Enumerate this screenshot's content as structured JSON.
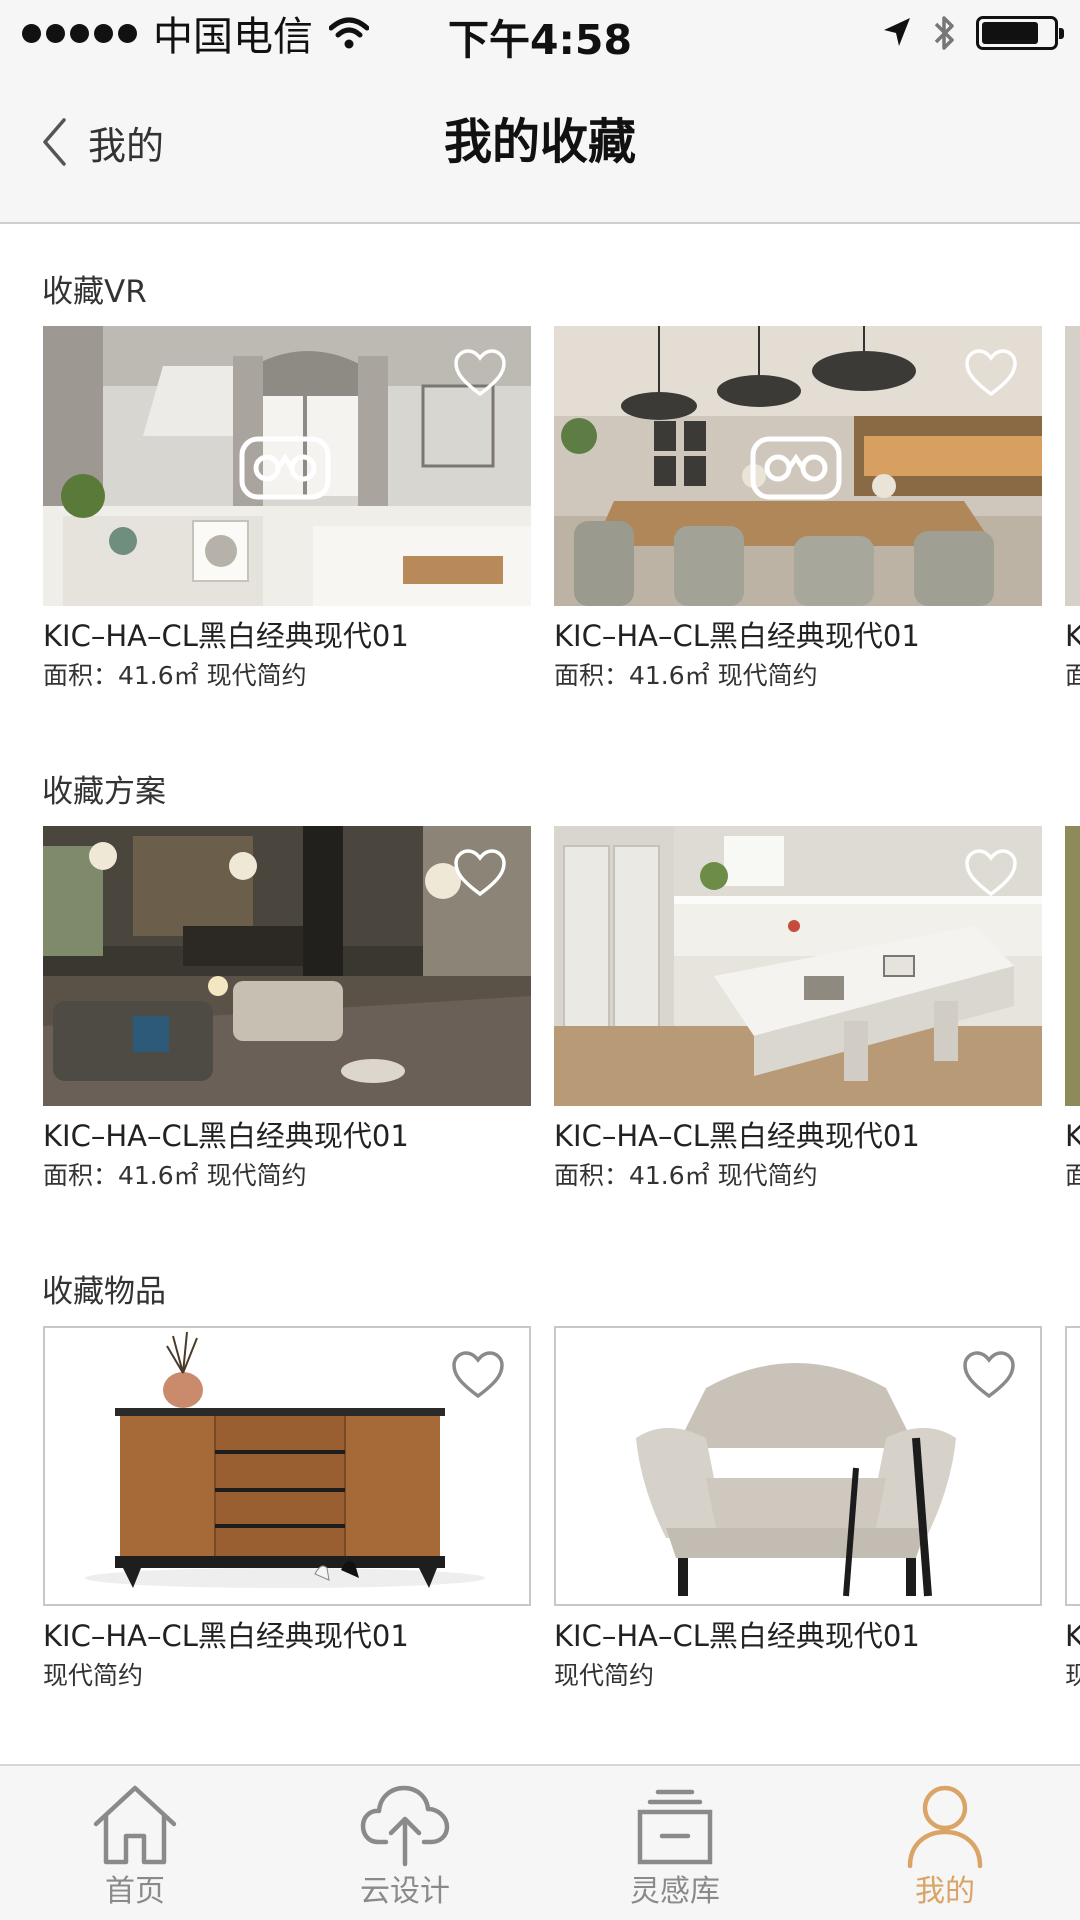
{
  "status_bar": {
    "carrier": "中国电信",
    "time": "下午4:58",
    "battery_level": 0.8
  },
  "nav": {
    "back_label": "我的",
    "title": "我的收藏"
  },
  "sections": [
    {
      "title": "收藏VR",
      "cards": [
        {
          "title": "KIC–HA–CL黑白经典现代01",
          "subtitle": "面积：41.6㎡ 现代简约",
          "image": "white-kitchen-render",
          "vr": true,
          "favorited": true
        },
        {
          "title": "KIC–HA–CL黑白经典现代01",
          "subtitle": "面积：41.6㎡ 现代简约",
          "image": "dining-room-render",
          "vr": true,
          "favorited": true
        },
        {
          "title": "K",
          "subtitle": "面",
          "image": "partial-card"
        }
      ]
    },
    {
      "title": "收藏方案",
      "cards": [
        {
          "title": "KIC–HA–CL黑白经典现代01",
          "subtitle": "面积：41.6㎡ 现代简约",
          "image": "dark-living-room-render",
          "favorited": true
        },
        {
          "title": "KIC–HA–CL黑白经典现代01",
          "subtitle": "面积：41.6㎡ 现代简约",
          "image": "kitchen-island-render",
          "favorited": true
        },
        {
          "title": "K",
          "subtitle": "面",
          "image": "partial-card"
        }
      ]
    },
    {
      "title": "收藏物品",
      "cards": [
        {
          "title": "KIC–HA–CL黑白经典现代01",
          "subtitle": "现代简约",
          "image": "wood-sideboard-product",
          "favorited": true
        },
        {
          "title": "KIC–HA–CL黑白经典现代01",
          "subtitle": "现代简约",
          "image": "armchair-product",
          "favorited": true
        },
        {
          "title": "K",
          "subtitle": "现",
          "image": "partial-card"
        }
      ]
    }
  ],
  "tabs": [
    {
      "label": "首页",
      "icon": "home-icon",
      "active": false
    },
    {
      "label": "云设计",
      "icon": "cloud-upload-icon",
      "active": false
    },
    {
      "label": "灵感库",
      "icon": "inbox-icon",
      "active": false
    },
    {
      "label": "我的",
      "icon": "person-icon",
      "active": true
    }
  ],
  "colors": {
    "accent": "#d9a466",
    "tab_inactive": "#8a8a8a",
    "bar_background": "#f6f6f6"
  }
}
